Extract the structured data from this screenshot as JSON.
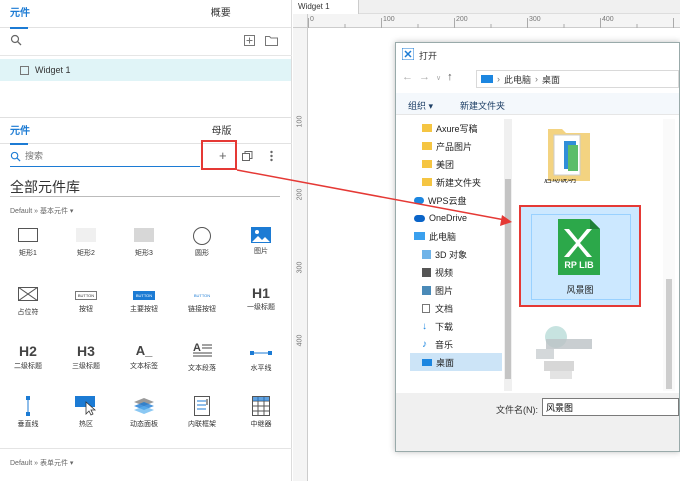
{
  "left_panel": {
    "top_tabs": [
      "元件",
      "概要"
    ],
    "widget_item": "Widget 1",
    "bottom_tabs": [
      "元件",
      "母版"
    ],
    "search_placeholder": "搜索",
    "library_title": "全部元件库",
    "section_basic": "Default » 基本元件 ▾",
    "section_form": "Default » 表单元件 ▾",
    "widgets": [
      {
        "label": "矩形1",
        "icon": "rect1-icon"
      },
      {
        "label": "矩形2",
        "icon": "rect2-icon"
      },
      {
        "label": "矩形3",
        "icon": "rect3-icon"
      },
      {
        "label": "圆形",
        "icon": "circle-icon"
      },
      {
        "label": "图片",
        "icon": "image-icon"
      },
      {
        "label": "占位符",
        "icon": "placeholder-icon"
      },
      {
        "label": "按钮",
        "icon": "button-icon",
        "glyph": "BUTTON"
      },
      {
        "label": "主要按钮",
        "icon": "primary-button-icon",
        "glyph": "BUTTON"
      },
      {
        "label": "链接按钮",
        "icon": "link-button-icon",
        "glyph": "BUTTON"
      },
      {
        "label": "一级标题",
        "icon": "h1-icon",
        "glyph": "H1"
      },
      {
        "label": "二级标题",
        "icon": "h2-icon",
        "glyph": "H2"
      },
      {
        "label": "三级标题",
        "icon": "h3-icon",
        "glyph": "H3"
      },
      {
        "label": "文本标签",
        "icon": "text-label-icon",
        "glyph": "A_"
      },
      {
        "label": "文本段落",
        "icon": "paragraph-icon",
        "glyph": "A"
      },
      {
        "label": "水平线",
        "icon": "hline-icon"
      },
      {
        "label": "垂直线",
        "icon": "vline-icon"
      },
      {
        "label": "热区",
        "icon": "hotspot-icon"
      },
      {
        "label": "动态面板",
        "icon": "dynamic-panel-icon"
      },
      {
        "label": "内联框架",
        "icon": "inline-frame-icon"
      },
      {
        "label": "中继器",
        "icon": "repeater-icon"
      }
    ]
  },
  "canvas": {
    "tab_label": "Widget 1",
    "ruler_top": [
      "0",
      "100",
      "200",
      "300",
      "400"
    ],
    "ruler_left": [
      "100",
      "200",
      "300",
      "400"
    ]
  },
  "dialog": {
    "title": "打开",
    "breadcrumb": [
      "此电脑",
      "桌面"
    ],
    "toolbar": {
      "organize": "组织 ▾",
      "new_folder": "新建文件夹"
    },
    "nav_items": [
      {
        "label": "Axure写稿",
        "icon": "folder-icon"
      },
      {
        "label": "产品图片",
        "icon": "folder-icon"
      },
      {
        "label": "美团",
        "icon": "folder-icon"
      },
      {
        "label": "新建文件夹",
        "icon": "folder-icon"
      },
      {
        "label": "WPS云盘",
        "icon": "cloud-icon"
      },
      {
        "label": "OneDrive",
        "icon": "onedrive-icon"
      },
      {
        "label": "此电脑",
        "icon": "pc-icon"
      },
      {
        "label": "3D 对象",
        "icon": "cube-icon"
      },
      {
        "label": "视频",
        "icon": "video-icon"
      },
      {
        "label": "图片",
        "icon": "picture-icon"
      },
      {
        "label": "文档",
        "icon": "doc-icon"
      },
      {
        "label": "下载",
        "icon": "download-icon"
      },
      {
        "label": "音乐",
        "icon": "music-icon"
      },
      {
        "label": "桌面",
        "icon": "desktop-icon"
      }
    ],
    "file_selected": {
      "name": "风景图",
      "badge": "RP LIB"
    },
    "file_top_partial": "启动说明",
    "filename_label": "文件名(N):",
    "filename_value": "风景图",
    "colors": {
      "accent": "#0078d7",
      "select_border": "#e02020",
      "rp_green": "#2ca84a"
    }
  },
  "annotation_color": "#e53935"
}
